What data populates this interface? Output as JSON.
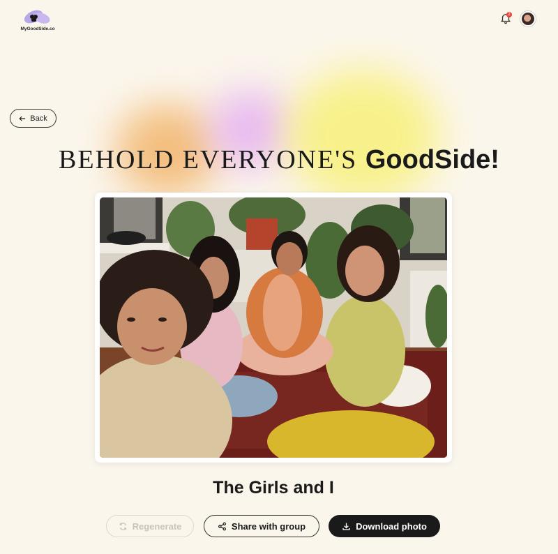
{
  "header": {
    "logo_text": "MyGoodSide.co",
    "notification_count": "2"
  },
  "nav": {
    "back_label": "Back"
  },
  "hero": {
    "headline_light": "BEHOLD EVERYONE'S",
    "headline_bold": "GoodSide!"
  },
  "photo": {
    "caption": "The Girls and I"
  },
  "actions": {
    "regenerate_label": "Regenerate",
    "share_label": "Share with group",
    "download_label": "Download photo"
  },
  "colors": {
    "background": "#fbf6ec",
    "primary_button": "#1a1a1a",
    "badge": "#e8463c"
  },
  "icons": {
    "logo": "butterfly-logo-icon",
    "notification": "bell-icon",
    "back": "arrow-left-icon",
    "regenerate": "refresh-icon",
    "share": "share-icon",
    "download": "download-icon"
  }
}
